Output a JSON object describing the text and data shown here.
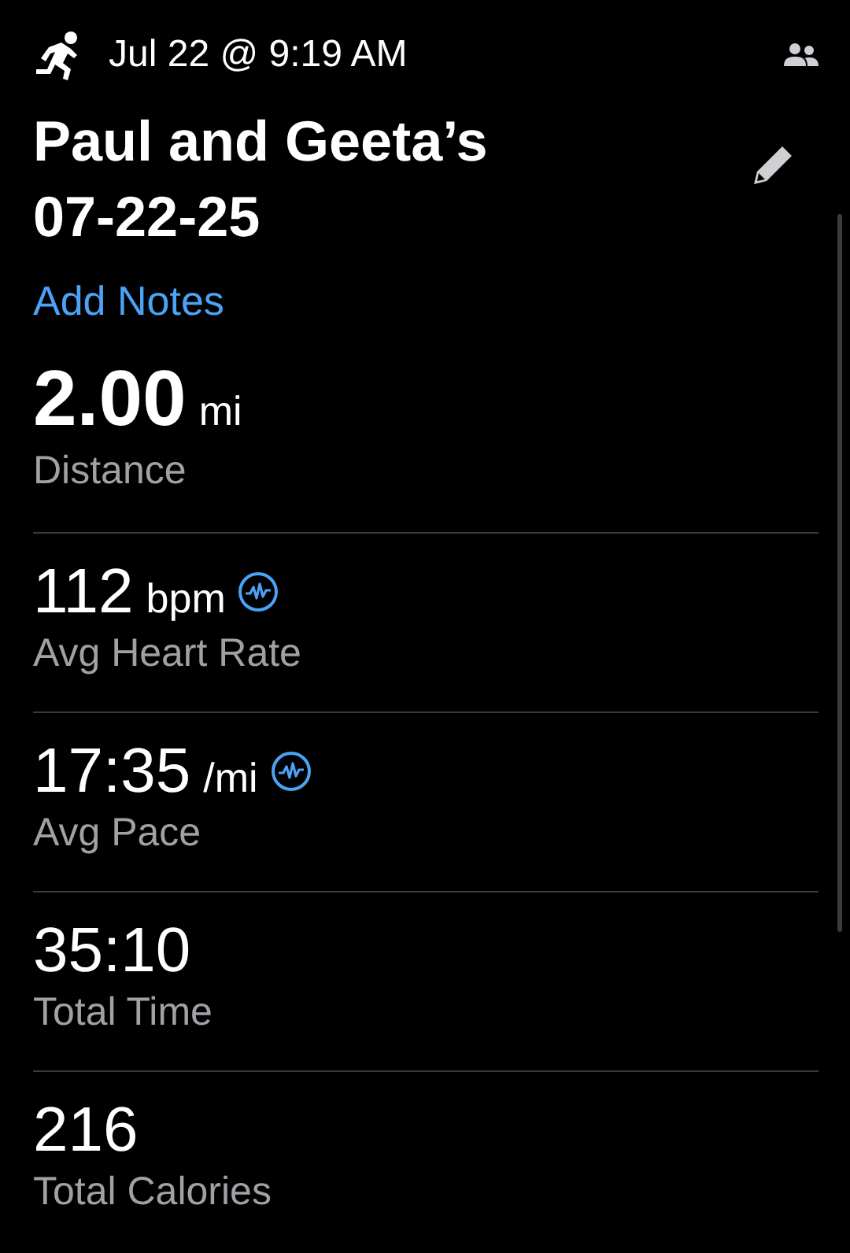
{
  "header": {
    "date": "Jul 22 @ 9:19 AM"
  },
  "title": "Paul and Geeta’s 07-22-25",
  "notes_link": "Add Notes",
  "stats": [
    {
      "kind": "primary",
      "value": "2.00",
      "unit": "mi",
      "label": "Distance",
      "has_chart": false
    },
    {
      "kind": "metric",
      "value": "112",
      "unit": "bpm",
      "label": "Avg Heart Rate",
      "has_chart": true
    },
    {
      "kind": "metric",
      "value": "17:35",
      "unit": "/mi",
      "label": "Avg Pace",
      "has_chart": true
    },
    {
      "kind": "metric",
      "value": "35:10",
      "label": "Total Time",
      "has_chart": false
    },
    {
      "kind": "metric",
      "value": "216",
      "label": "Total Calories",
      "has_chart": false
    }
  ]
}
